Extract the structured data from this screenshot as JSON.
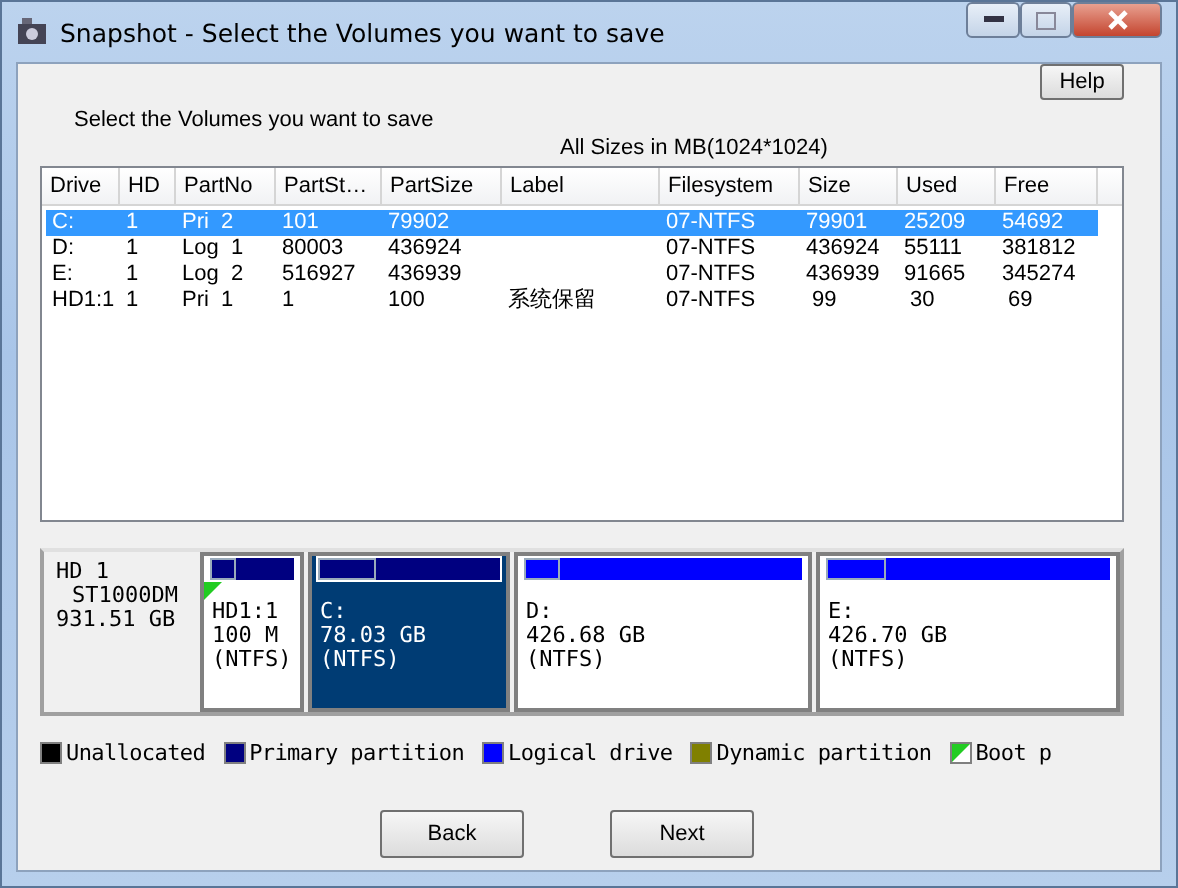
{
  "window": {
    "title": "Snapshot - Select the Volumes you want to save"
  },
  "help_button": "Help",
  "instruction": "Select the Volumes you want to save",
  "size_note": "All Sizes in MB(1024*1024)",
  "table": {
    "columns": [
      "Drive",
      "HD",
      "PartNo",
      "PartSt…",
      "PartSize",
      "Label",
      "Filesystem",
      "Size",
      "Used",
      "Free"
    ],
    "rows": [
      {
        "selected": true,
        "cells": [
          "C:",
          "1",
          "Pri  2",
          "101",
          "79902",
          "",
          "07-NTFS",
          "79901",
          "25209",
          "54692"
        ]
      },
      {
        "selected": false,
        "cells": [
          "D:",
          "1",
          "Log  1",
          "80003",
          "436924",
          "",
          "07-NTFS",
          "436924",
          "55111",
          "381812"
        ]
      },
      {
        "selected": false,
        "cells": [
          "E:",
          "1",
          "Log  2",
          "516927",
          "436939",
          "",
          "07-NTFS",
          "436939",
          "91665",
          "345274"
        ]
      },
      {
        "selected": false,
        "cells": [
          "HD1:1",
          "1",
          "Pri  1",
          "1",
          "100",
          "系统保留",
          "07-NTFS",
          " 99",
          " 30",
          " 69"
        ]
      }
    ]
  },
  "disk": {
    "name": "HD 1",
    "model": "ST1000DM",
    "size": "931.51 GB",
    "partitions": [
      {
        "kind": "primary",
        "boot": true,
        "selected": false,
        "level": 0.3,
        "name": "HD1:1",
        "size": "100 M",
        "fs": "(NTFS)"
      },
      {
        "kind": "primary",
        "boot": false,
        "selected": true,
        "level": 0.32,
        "name": "C:",
        "size": "78.03 GB",
        "fs": "(NTFS)"
      },
      {
        "kind": "logical",
        "boot": false,
        "selected": false,
        "level": 0.13,
        "name": "D:",
        "size": "426.68 GB",
        "fs": "(NTFS)"
      },
      {
        "kind": "logical",
        "boot": false,
        "selected": false,
        "level": 0.21,
        "name": "E:",
        "size": "426.70 GB",
        "fs": "(NTFS)"
      }
    ]
  },
  "legend": [
    {
      "kind": "solid",
      "color": "#000000",
      "label": "Unallocated"
    },
    {
      "kind": "solid",
      "color": "#000080",
      "label": "Primary partition"
    },
    {
      "kind": "solid",
      "color": "#0000ff",
      "label": "Logical drive"
    },
    {
      "kind": "solid",
      "color": "#808000",
      "label": "Dynamic partition"
    },
    {
      "kind": "boot",
      "color": "#22cc22",
      "label": "Boot p"
    }
  ],
  "buttons": [
    "Back",
    "Next"
  ]
}
